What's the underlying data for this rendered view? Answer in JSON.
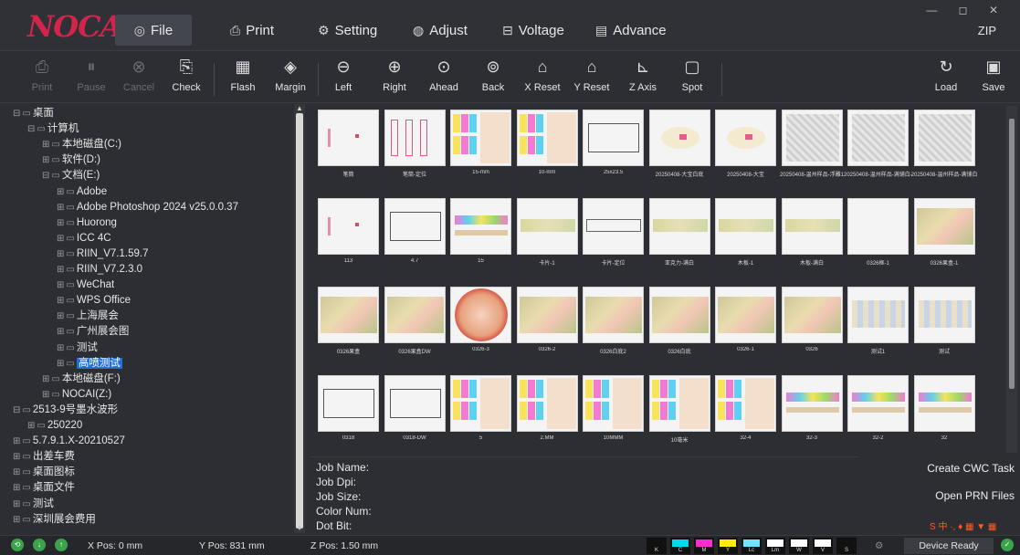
{
  "app": {
    "logo_text": "NOCAI",
    "window_controls": "— ◻ ✕",
    "zip_label": "ZIP"
  },
  "menu": [
    {
      "label": "File",
      "icon": "◎"
    },
    {
      "label": "Print",
      "icon": "⎙"
    },
    {
      "label": "Setting",
      "icon": "⚙"
    },
    {
      "label": "Adjust",
      "icon": "◍"
    },
    {
      "label": "Voltage",
      "icon": "⊟"
    },
    {
      "label": "Advance",
      "icon": "▤"
    }
  ],
  "toolbar": [
    {
      "label": "Print",
      "icon": "⎙",
      "enabled": false
    },
    {
      "label": "Pause",
      "icon": "⏸",
      "enabled": false
    },
    {
      "label": "Cancel",
      "icon": "⊗",
      "enabled": false
    },
    {
      "label": "Check",
      "icon": "⎘",
      "enabled": true
    },
    {
      "label": "Flash",
      "icon": "▦",
      "enabled": true
    },
    {
      "label": "Margin",
      "icon": "◈",
      "enabled": true
    },
    {
      "label": "Left",
      "icon": "⊖",
      "enabled": true
    },
    {
      "label": "Right",
      "icon": "⊕",
      "enabled": true
    },
    {
      "label": "Ahead",
      "icon": "⊙",
      "enabled": true
    },
    {
      "label": "Back",
      "icon": "⊚",
      "enabled": true
    },
    {
      "label": "X Reset",
      "icon": "⌂",
      "enabled": true
    },
    {
      "label": "Y Reset",
      "icon": "⌂",
      "enabled": true
    },
    {
      "label": "Z Axis",
      "icon": "⊾",
      "enabled": true
    },
    {
      "label": "Spot",
      "icon": "▢",
      "enabled": true
    },
    {
      "label": "Load",
      "icon": "↻",
      "enabled": true
    },
    {
      "label": "Save",
      "icon": "▣",
      "enabled": true
    }
  ],
  "tree": [
    {
      "label": "桌面",
      "glyph": "⊟",
      "level": 0
    },
    {
      "label": "计算机",
      "glyph": "⊟",
      "level": 1
    },
    {
      "label": "本地磁盘(C:)",
      "glyph": "⊞",
      "level": 2
    },
    {
      "label": "软件(D:)",
      "glyph": "⊞",
      "level": 2
    },
    {
      "label": "文档(E:)",
      "glyph": "⊟",
      "level": 2
    },
    {
      "label": "Adobe",
      "glyph": "⊞",
      "level": 3
    },
    {
      "label": "Adobe Photoshop 2024 v25.0.0.37",
      "glyph": "⊞",
      "level": 3
    },
    {
      "label": "Huorong",
      "glyph": "⊞",
      "level": 3
    },
    {
      "label": "ICC 4C",
      "glyph": "⊞",
      "level": 3
    },
    {
      "label": "RIIN_V7.1.59.7",
      "glyph": "⊞",
      "level": 3
    },
    {
      "label": "RIIN_V7.2.3.0",
      "glyph": "⊞",
      "level": 3
    },
    {
      "label": "WeChat",
      "glyph": "⊞",
      "level": 3
    },
    {
      "label": "WPS Office",
      "glyph": "⊞",
      "level": 3
    },
    {
      "label": "上海展会",
      "glyph": "⊞",
      "level": 3
    },
    {
      "label": "广州展会图",
      "glyph": "⊞",
      "level": 3
    },
    {
      "label": "测试",
      "glyph": "⊞",
      "level": 3
    },
    {
      "label": "高喷测试",
      "glyph": "⊞",
      "level": 3,
      "selected": true
    },
    {
      "label": "本地磁盘(F:)",
      "glyph": "⊞",
      "level": 2
    },
    {
      "label": "NOCAI(Z:)",
      "glyph": "⊞",
      "level": 2
    },
    {
      "label": "2513-9号墨水波形",
      "glyph": "⊟",
      "level": 0
    },
    {
      "label": "250220",
      "glyph": "⊞",
      "level": 1
    },
    {
      "label": "5.7.9.1.X-20210527",
      "glyph": "⊞",
      "level": 0
    },
    {
      "label": "出差车费",
      "glyph": "⊞",
      "level": 0
    },
    {
      "label": "桌面图标",
      "glyph": "⊞",
      "level": 0
    },
    {
      "label": "桌面文件",
      "glyph": "⊞",
      "level": 0
    },
    {
      "label": "测试",
      "glyph": "⊞",
      "level": 0
    },
    {
      "label": "深圳展会费用",
      "glyph": "⊞",
      "level": 0
    }
  ],
  "thumbnails": [
    {
      "caption": "笔筒",
      "kind": "sparse"
    },
    {
      "caption": "笔筒-定位",
      "kind": "frames"
    },
    {
      "caption": "15-mm",
      "kind": "bars"
    },
    {
      "caption": "10-mm",
      "kind": "bars"
    },
    {
      "caption": "25x23.5",
      "kind": "frame"
    },
    {
      "caption": "20250408-大宝白底",
      "kind": "faint"
    },
    {
      "caption": "20250408-大宝",
      "kind": "faint"
    },
    {
      "caption": "20250408-温州样品-浮雕1",
      "kind": "sketch"
    },
    {
      "caption": "20250408-温州样品-满铺白-正面白彩",
      "kind": "sketch"
    },
    {
      "caption": "20250408-温州样品-满铺白",
      "kind": "sketch"
    },
    {
      "caption": "113",
      "kind": "sparse"
    },
    {
      "caption": "4.7",
      "kind": "frame"
    },
    {
      "caption": "15",
      "kind": "strip"
    },
    {
      "caption": "卡片-1",
      "kind": "band"
    },
    {
      "caption": "卡片-定位",
      "kind": "bandframe"
    },
    {
      "caption": "亚克力-满白",
      "kind": "band"
    },
    {
      "caption": "木板-1",
      "kind": "band"
    },
    {
      "caption": "木板-满白",
      "kind": "band"
    },
    {
      "caption": "0326框-1",
      "kind": "blank"
    },
    {
      "caption": "0326果盒-1",
      "kind": "photo"
    },
    {
      "caption": "0326果盒",
      "kind": "photo"
    },
    {
      "caption": "0326果盒DW",
      "kind": "photo"
    },
    {
      "caption": "0326-3",
      "kind": "circle"
    },
    {
      "caption": "0326-2",
      "kind": "photo"
    },
    {
      "caption": "0326白底2",
      "kind": "photo"
    },
    {
      "caption": "0326白底",
      "kind": "photo"
    },
    {
      "caption": "0326-1",
      "kind": "photo"
    },
    {
      "caption": "0326",
      "kind": "photo"
    },
    {
      "caption": "测试1",
      "kind": "grid"
    },
    {
      "caption": "测试",
      "kind": "grid"
    },
    {
      "caption": "0318",
      "kind": "frame"
    },
    {
      "caption": "0318-DW",
      "kind": "frame"
    },
    {
      "caption": "5",
      "kind": "bars"
    },
    {
      "caption": "2.MM",
      "kind": "bars"
    },
    {
      "caption": "10MMM",
      "kind": "bars"
    },
    {
      "caption": "10毫米",
      "kind": "bars"
    },
    {
      "caption": "32-4",
      "kind": "bars"
    },
    {
      "caption": "32-3",
      "kind": "strip"
    },
    {
      "caption": "32-2",
      "kind": "strip"
    },
    {
      "caption": "32",
      "kind": "strip"
    }
  ],
  "job_info": {
    "job_name": "Job Name:",
    "job_dpi": "Job Dpi:",
    "job_size": "Job Size:",
    "color_num": "Color Num:",
    "dot_bit": "Dot Bit:"
  },
  "side_buttons": {
    "create_cwc": "Create CWC Task",
    "open_prn": "Open PRN Files"
  },
  "brand_icons": "S 中 ·, ♦ ▦ ▼ ▦",
  "status": {
    "x_pos": "X Pos: 0 mm",
    "y_pos": "Y Pos: 831 mm",
    "z_pos": "Z Pos: 1.50 mm",
    "device_state": "Device Ready",
    "inks": [
      {
        "label": "K",
        "color": "#111111"
      },
      {
        "label": "C",
        "color": "#00d8f0"
      },
      {
        "label": "M",
        "color": "#ff2ad0"
      },
      {
        "label": "Y",
        "color": "#ffee00"
      },
      {
        "label": "Lc",
        "color": "#6ee6ff"
      },
      {
        "label": "Lm",
        "color": "#ffffff"
      },
      {
        "label": "W",
        "color": "#ffffff"
      },
      {
        "label": "V",
        "color": "#ffffff"
      },
      {
        "label": "S",
        "color": "#111111"
      }
    ]
  },
  "colors": {
    "accent": "#1f6fd6",
    "logo": "#d3254b",
    "status_ok": "#3ba34a"
  }
}
